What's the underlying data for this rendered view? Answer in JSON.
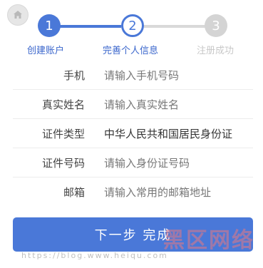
{
  "steps": [
    {
      "number": "1",
      "label": "创建账户",
      "state": "done"
    },
    {
      "number": "2",
      "label": "完善个人信息",
      "state": "current"
    },
    {
      "number": "3",
      "label": "注册成功",
      "state": "pending"
    }
  ],
  "form": {
    "phone": {
      "label": "手机",
      "placeholder": "请输入手机号码"
    },
    "real_name": {
      "label": "真实姓名",
      "placeholder": "请输入真实姓名"
    },
    "id_type": {
      "label": "证件类型",
      "value": "中华人民共和国居民身份证"
    },
    "id_number": {
      "label": "证件号码",
      "placeholder": "请输入身份证号码"
    },
    "email": {
      "label": "邮箱",
      "placeholder": "请输入常用的邮箱地址"
    }
  },
  "submit_label": "下一步 完成",
  "colors": {
    "accent": "#4a78d8",
    "inactive": "#d4d4d4"
  },
  "watermark": {
    "text": "黑区网络",
    "url": "https://blog.www.heiqu.com"
  }
}
